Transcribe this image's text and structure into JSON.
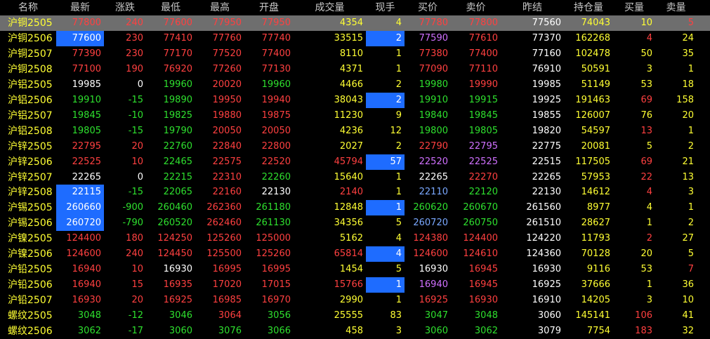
{
  "colors": {
    "up": "#ff4040",
    "down": "#2ee02e",
    "flat": "#ffffff",
    "yellow": "#ffff33",
    "purple": "#d070ff",
    "blue": "#7aa8ff",
    "highlight": "#1e6cff",
    "selected_row": "#6e6e6e"
  },
  "columns": [
    "名称",
    "最新",
    "涨跌",
    "最低",
    "最高",
    "开盘",
    "成交量",
    "现手",
    "买价",
    "卖价",
    "昨结",
    "持仓量",
    "买量",
    "卖量"
  ],
  "selected_row": 0,
  "rows": [
    {
      "cells": [
        "沪铜2505",
        "77800",
        "240",
        "77600",
        "77950",
        "77950",
        "4354",
        "4",
        "77780",
        "77800",
        "77560",
        "74043",
        "10",
        "5"
      ],
      "colors": [
        "yellow",
        "red",
        "red",
        "red",
        "red",
        "red",
        "yellow",
        "yellow",
        "red",
        "red",
        "white",
        "yellow",
        "yellow",
        "red"
      ],
      "hl": []
    },
    {
      "cells": [
        "沪铜2506",
        "77600",
        "230",
        "77410",
        "77760",
        "77740",
        "33515",
        "2",
        "77590",
        "77610",
        "77370",
        "162268",
        "4",
        "24"
      ],
      "colors": [
        "yellow",
        "red",
        "red",
        "red",
        "red",
        "red",
        "yellow",
        "yellow",
        "purple",
        "red",
        "white",
        "yellow",
        "red",
        "yellow"
      ],
      "hl": [
        1,
        7
      ]
    },
    {
      "cells": [
        "沪铜2507",
        "77390",
        "230",
        "77170",
        "77520",
        "77400",
        "8110",
        "1",
        "77380",
        "77400",
        "77160",
        "102478",
        "50",
        "35"
      ],
      "colors": [
        "yellow",
        "red",
        "red",
        "red",
        "red",
        "red",
        "yellow",
        "yellow",
        "red",
        "red",
        "white",
        "yellow",
        "yellow",
        "yellow"
      ],
      "hl": []
    },
    {
      "cells": [
        "沪铜2508",
        "77100",
        "190",
        "76920",
        "77260",
        "77130",
        "4371",
        "1",
        "77090",
        "77110",
        "76910",
        "50591",
        "3",
        "1"
      ],
      "colors": [
        "yellow",
        "red",
        "red",
        "red",
        "red",
        "red",
        "yellow",
        "yellow",
        "red",
        "red",
        "white",
        "yellow",
        "yellow",
        "yellow"
      ],
      "hl": []
    },
    {
      "cells": [
        "沪铝2505",
        "19985",
        "0",
        "19960",
        "20020",
        "19960",
        "4466",
        "2",
        "19980",
        "19990",
        "19985",
        "51149",
        "53",
        "18"
      ],
      "colors": [
        "yellow",
        "white",
        "white",
        "green",
        "red",
        "green",
        "yellow",
        "yellow",
        "green",
        "red",
        "white",
        "yellow",
        "yellow",
        "yellow"
      ],
      "hl": []
    },
    {
      "cells": [
        "沪铝2506",
        "19910",
        "-15",
        "19890",
        "19950",
        "19940",
        "38043",
        "2",
        "19910",
        "19915",
        "19925",
        "191463",
        "69",
        "158"
      ],
      "colors": [
        "yellow",
        "green",
        "green",
        "green",
        "red",
        "red",
        "yellow",
        "yellow",
        "green",
        "green",
        "white",
        "yellow",
        "red",
        "yellow"
      ],
      "hl": [
        7
      ]
    },
    {
      "cells": [
        "沪铝2507",
        "19845",
        "-10",
        "19825",
        "19880",
        "19875",
        "11230",
        "9",
        "19840",
        "19845",
        "19855",
        "126007",
        "76",
        "20"
      ],
      "colors": [
        "yellow",
        "green",
        "green",
        "green",
        "red",
        "red",
        "yellow",
        "yellow",
        "green",
        "green",
        "white",
        "yellow",
        "yellow",
        "yellow"
      ],
      "hl": []
    },
    {
      "cells": [
        "沪铝2508",
        "19805",
        "-15",
        "19790",
        "20050",
        "20050",
        "4236",
        "12",
        "19800",
        "19805",
        "19820",
        "54597",
        "13",
        "1"
      ],
      "colors": [
        "yellow",
        "green",
        "green",
        "green",
        "red",
        "red",
        "yellow",
        "yellow",
        "green",
        "green",
        "white",
        "yellow",
        "red",
        "yellow"
      ],
      "hl": []
    },
    {
      "cells": [
        "沪锌2505",
        "22795",
        "20",
        "22760",
        "22840",
        "22800",
        "2027",
        "2",
        "22790",
        "22795",
        "22775",
        "20081",
        "5",
        "2"
      ],
      "colors": [
        "yellow",
        "red",
        "red",
        "green",
        "red",
        "red",
        "yellow",
        "yellow",
        "red",
        "purple",
        "white",
        "yellow",
        "yellow",
        "yellow"
      ],
      "hl": []
    },
    {
      "cells": [
        "沪锌2506",
        "22525",
        "10",
        "22465",
        "22575",
        "22520",
        "45794",
        "57",
        "22520",
        "22525",
        "22515",
        "117505",
        "69",
        "21"
      ],
      "colors": [
        "yellow",
        "red",
        "red",
        "green",
        "red",
        "red",
        "red",
        "yellow",
        "purple",
        "purple",
        "white",
        "yellow",
        "red",
        "yellow"
      ],
      "hl": [
        7
      ]
    },
    {
      "cells": [
        "沪锌2507",
        "22265",
        "0",
        "22215",
        "22310",
        "22260",
        "15640",
        "1",
        "22265",
        "22270",
        "22265",
        "57953",
        "22",
        "13"
      ],
      "colors": [
        "yellow",
        "white",
        "white",
        "green",
        "red",
        "green",
        "yellow",
        "yellow",
        "white",
        "red",
        "white",
        "yellow",
        "red",
        "yellow"
      ],
      "hl": []
    },
    {
      "cells": [
        "沪锌2508",
        "22115",
        "-15",
        "22065",
        "22160",
        "22130",
        "2140",
        "1",
        "22110",
        "22120",
        "22130",
        "14612",
        "4",
        "3"
      ],
      "colors": [
        "yellow",
        "green",
        "green",
        "green",
        "red",
        "white",
        "red",
        "yellow",
        "blue",
        "green",
        "white",
        "yellow",
        "red",
        "yellow"
      ],
      "hl": [
        1
      ]
    },
    {
      "cells": [
        "沪锡2505",
        "260660",
        "-900",
        "260460",
        "262360",
        "261180",
        "12848",
        "1",
        "260620",
        "260670",
        "261560",
        "8977",
        "4",
        "1"
      ],
      "colors": [
        "yellow",
        "green",
        "green",
        "green",
        "red",
        "green",
        "yellow",
        "yellow",
        "green",
        "green",
        "white",
        "yellow",
        "yellow",
        "yellow"
      ],
      "hl": [
        1,
        7
      ]
    },
    {
      "cells": [
        "沪锡2506",
        "260720",
        "-790",
        "260520",
        "262460",
        "261130",
        "34356",
        "5",
        "260720",
        "260750",
        "261510",
        "28627",
        "1",
        "2"
      ],
      "colors": [
        "yellow",
        "green",
        "green",
        "green",
        "red",
        "green",
        "yellow",
        "yellow",
        "blue",
        "green",
        "white",
        "yellow",
        "yellow",
        "yellow"
      ],
      "hl": [
        1
      ]
    },
    {
      "cells": [
        "沪镍2505",
        "124400",
        "180",
        "124250",
        "125260",
        "125000",
        "5162",
        "4",
        "124380",
        "124400",
        "124220",
        "11793",
        "2",
        "27"
      ],
      "colors": [
        "yellow",
        "red",
        "red",
        "red",
        "red",
        "red",
        "yellow",
        "yellow",
        "red",
        "red",
        "white",
        "yellow",
        "red",
        "yellow"
      ],
      "hl": []
    },
    {
      "cells": [
        "沪镍2506",
        "124600",
        "240",
        "124450",
        "125500",
        "125260",
        "65814",
        "4",
        "124600",
        "124610",
        "124360",
        "70128",
        "20",
        "5"
      ],
      "colors": [
        "yellow",
        "red",
        "red",
        "red",
        "red",
        "red",
        "red",
        "yellow",
        "red",
        "red",
        "white",
        "yellow",
        "yellow",
        "yellow"
      ],
      "hl": [
        7
      ]
    },
    {
      "cells": [
        "沪铅2505",
        "16940",
        "10",
        "16930",
        "16995",
        "16995",
        "1454",
        "5",
        "16930",
        "16945",
        "16930",
        "9116",
        "53",
        "7"
      ],
      "colors": [
        "yellow",
        "red",
        "red",
        "white",
        "red",
        "red",
        "yellow",
        "yellow",
        "white",
        "red",
        "white",
        "yellow",
        "yellow",
        "red"
      ],
      "hl": []
    },
    {
      "cells": [
        "沪铅2506",
        "16940",
        "15",
        "16935",
        "17020",
        "17015",
        "15766",
        "1",
        "16940",
        "16945",
        "16925",
        "37666",
        "1",
        "36"
      ],
      "colors": [
        "yellow",
        "red",
        "red",
        "red",
        "red",
        "red",
        "red",
        "yellow",
        "purple",
        "red",
        "white",
        "yellow",
        "yellow",
        "yellow"
      ],
      "hl": [
        7
      ]
    },
    {
      "cells": [
        "沪铅2507",
        "16930",
        "20",
        "16925",
        "16985",
        "16970",
        "2990",
        "1",
        "16925",
        "16930",
        "16910",
        "14205",
        "3",
        "10"
      ],
      "colors": [
        "yellow",
        "red",
        "red",
        "red",
        "red",
        "red",
        "yellow",
        "yellow",
        "red",
        "red",
        "white",
        "yellow",
        "yellow",
        "yellow"
      ],
      "hl": []
    },
    {
      "cells": [
        "螺纹2505",
        "3048",
        "-12",
        "3046",
        "3064",
        "3056",
        "25555",
        "83",
        "3047",
        "3048",
        "3060",
        "145141",
        "106",
        "41"
      ],
      "colors": [
        "yellow",
        "green",
        "green",
        "green",
        "red",
        "green",
        "yellow",
        "yellow",
        "green",
        "green",
        "white",
        "yellow",
        "red",
        "yellow"
      ],
      "hl": []
    },
    {
      "cells": [
        "螺纹2506",
        "3062",
        "-17",
        "3060",
        "3076",
        "3066",
        "458",
        "3",
        "3060",
        "3062",
        "3079",
        "7754",
        "183",
        "32"
      ],
      "colors": [
        "yellow",
        "green",
        "green",
        "green",
        "green",
        "green",
        "yellow",
        "yellow",
        "green",
        "green",
        "white",
        "yellow",
        "red",
        "yellow"
      ],
      "hl": []
    }
  ]
}
